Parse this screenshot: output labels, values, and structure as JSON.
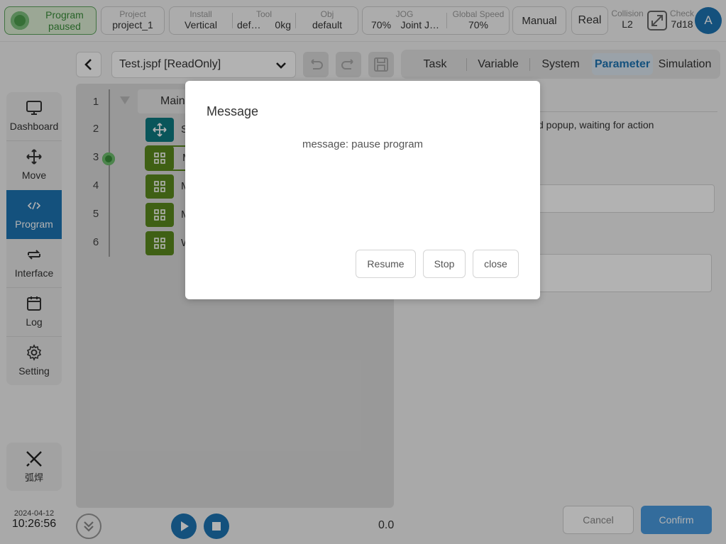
{
  "status": {
    "program_label": "Program paused",
    "line1": "Program",
    "line2": "paused",
    "color": "#3a8f3a"
  },
  "project": {
    "label": "Project",
    "value": "project_1"
  },
  "install": {
    "label": "Install",
    "value": "Vertical"
  },
  "tool": {
    "label": "Tool",
    "value_name": "def…",
    "value_mass": "0kg"
  },
  "obj": {
    "label": "Obj",
    "value": "default"
  },
  "jog": {
    "label": "JOG",
    "value_speed": "70%",
    "value_mode": "Joint J…"
  },
  "global_speed": {
    "label": "Global Speed",
    "value": "70%"
  },
  "mode_button": "Manual",
  "real_button": "Real",
  "collision": {
    "label": "Collision",
    "value": "L2"
  },
  "check": {
    "label": "Check",
    "value": "7d18"
  },
  "avatar_letter": "A",
  "sidebar": {
    "items": [
      {
        "label": "Dashboard",
        "icon": "monitor-icon"
      },
      {
        "label": "Move",
        "icon": "move-arrows-icon"
      },
      {
        "label": "Program",
        "icon": "code-icon"
      },
      {
        "label": "Interface",
        "icon": "swap-arrows-icon"
      },
      {
        "label": "Log",
        "icon": "calendar-icon"
      },
      {
        "label": "Setting",
        "icon": "gear-icon"
      }
    ],
    "active_index": 2,
    "plugin_label": "弧焊"
  },
  "editor": {
    "file_select": "Test.jspf [ReadOnly]",
    "line_numbers": [
      "1",
      "2",
      "3",
      "4",
      "5",
      "6"
    ],
    "main_label": "Main",
    "block_first_letters": [
      "S",
      "M",
      "M",
      "M",
      "W"
    ],
    "progress_value": "0.0"
  },
  "tabs": [
    "Task",
    "Variable",
    "System",
    "Parameter",
    "Simulation"
  ],
  "active_tab": "Parameter",
  "right_panel": {
    "partial_text": "d popup, waiting for action"
  },
  "footer_buttons": {
    "cancel": "Cancel",
    "confirm": "Confirm"
  },
  "datetime": {
    "date": "2024-04-12",
    "time": "10:26:56"
  },
  "dialog": {
    "title": "Message",
    "message": "message: pause program",
    "buttons": {
      "resume": "Resume",
      "stop": "Stop",
      "close": "close"
    }
  },
  "colors": {
    "accent": "#1e74b3",
    "green_block": "#5b8a1e",
    "teal_block": "#0e7a82",
    "status_green": "#3a8f3a"
  }
}
